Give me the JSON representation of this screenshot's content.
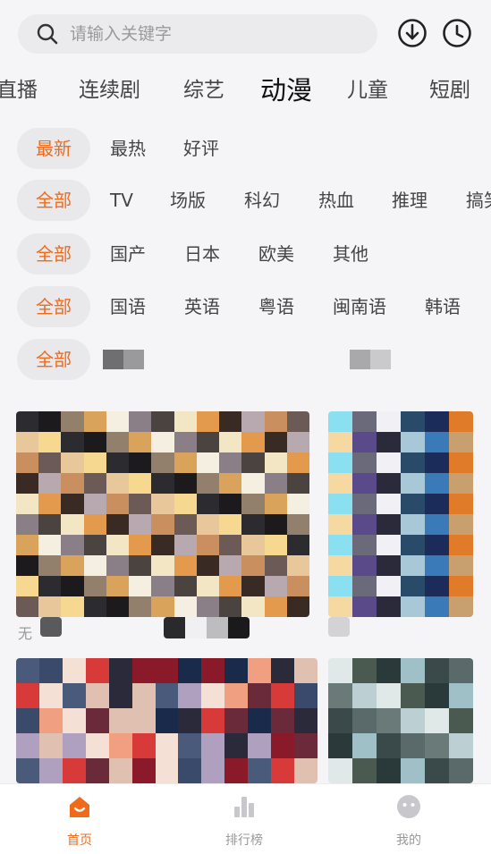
{
  "search": {
    "placeholder": "请输入关键字"
  },
  "icons": {
    "search": "search-icon",
    "download": "download-icon",
    "history": "history-icon"
  },
  "tabs": [
    "直播",
    "连续剧",
    "综艺",
    "动漫",
    "儿童",
    "短剧"
  ],
  "active_tab": "动漫",
  "filters": {
    "sort": [
      "最新",
      "最热",
      "好评"
    ],
    "genre": [
      "全部",
      "TV",
      "场版",
      "科幻",
      "热血",
      "推理",
      "搞笑"
    ],
    "region": [
      "全部",
      "国产",
      "日本",
      "欧美",
      "其他"
    ],
    "language": [
      "全部",
      "国语",
      "英语",
      "粤语",
      "闽南语",
      "韩语"
    ],
    "year": [
      "全部"
    ]
  },
  "grid_labels": {
    "card1_corner": "无"
  },
  "bottom_nav": [
    {
      "label": "首页",
      "icon": "home-icon",
      "active": true
    },
    {
      "label": "排行榜",
      "icon": "chart-icon",
      "active": false
    },
    {
      "label": "我的",
      "icon": "profile-icon",
      "active": false
    }
  ],
  "colors": {
    "accent": "#f06a1a",
    "chip_bg": "#e9e9ec",
    "background": "#f5f5f7"
  }
}
